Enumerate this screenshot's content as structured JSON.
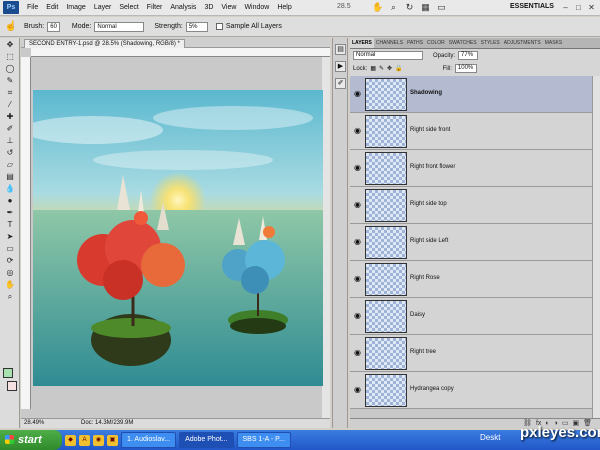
{
  "app": {
    "logo": "Ps",
    "workspace": "ESSENTIALS",
    "zoom_readout": "28.5"
  },
  "menu": [
    "File",
    "Edit",
    "Image",
    "Layer",
    "Select",
    "Filter",
    "Analysis",
    "3D",
    "View",
    "Window",
    "Help"
  ],
  "options": {
    "brush_label": "Brush:",
    "brush_size": "60",
    "mode_label": "Mode:",
    "mode_value": "Normal",
    "strength_label": "Strength:",
    "strength_value": "5%",
    "sample_all_label": "Sample All Layers"
  },
  "document": {
    "tab_title": "SECOND ENTRY-1.psd @ 28.5% (Shadowing, RGB/8) *",
    "zoom": "28.49%",
    "doc_info": "Doc: 14.3M/239.9M"
  },
  "layers_panel": {
    "tabs": [
      "LAYERS",
      "CHANNELS",
      "PATHS",
      "COLOR",
      "SWATCHES",
      "STYLES",
      "ADJUSTMENTS",
      "MASKS"
    ],
    "blend_mode": "Normal",
    "opacity_label": "Opacity:",
    "opacity_value": "77%",
    "lock_label": "Lock:",
    "fill_label": "Fill:",
    "fill_value": "100%",
    "layers": [
      {
        "name": "Shadowing",
        "selected": true
      },
      {
        "name": "Right side front"
      },
      {
        "name": "Right front flower"
      },
      {
        "name": "Right side top"
      },
      {
        "name": "Right side Left"
      },
      {
        "name": "Right Rose"
      },
      {
        "name": "Daisy"
      },
      {
        "name": "Right tree"
      },
      {
        "name": "Hydrangea copy"
      }
    ]
  },
  "taskbar": {
    "start_label": "start",
    "buttons": [
      "1. Audioslav...",
      "Adobe Phot...",
      "SBS 1-A - P..."
    ],
    "tray_label": "Deskt"
  },
  "watermark": "pxleyes.com"
}
